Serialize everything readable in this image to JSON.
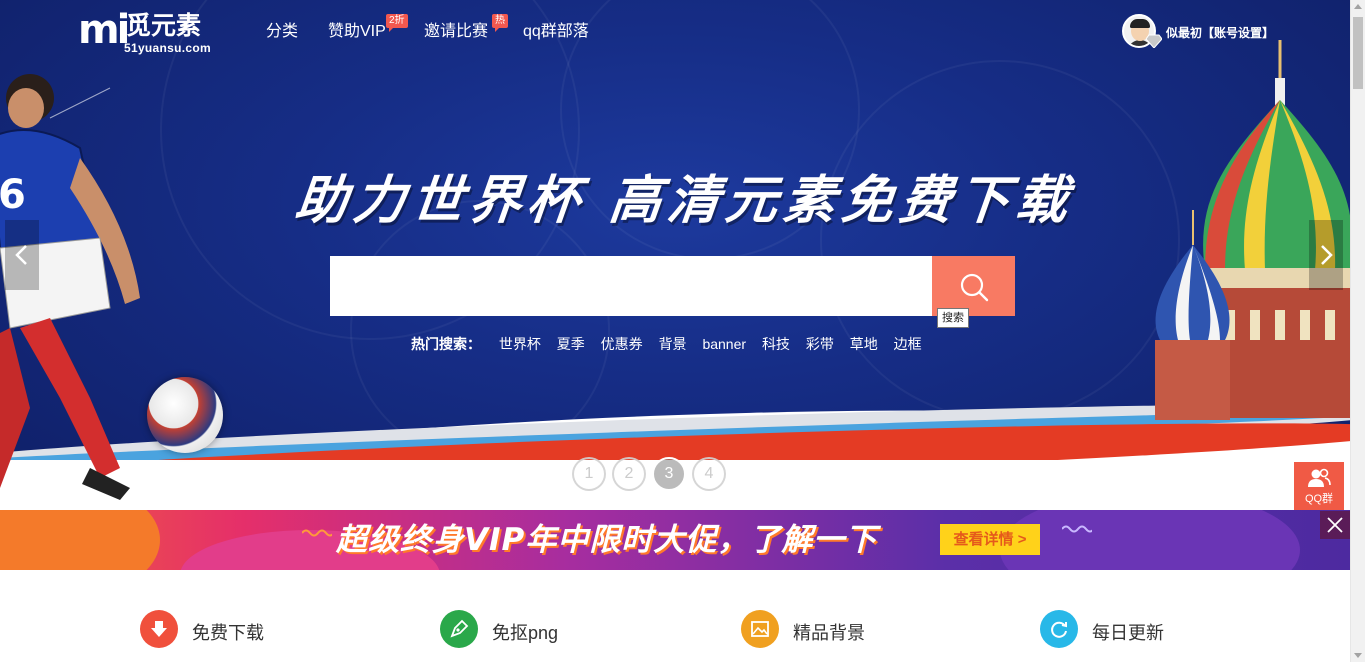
{
  "logo": {
    "mark": "mi",
    "name_cn": "觅元素",
    "domain": "51yuansu.com"
  },
  "nav": {
    "items": [
      {
        "label": "分类"
      },
      {
        "label": "赞助VIP",
        "badge": "2折"
      },
      {
        "label": "邀请比赛",
        "badge": "热"
      },
      {
        "label": "qq群部落"
      }
    ]
  },
  "user": {
    "name": "似最初【账号设置】"
  },
  "hero": {
    "headline": "助力世界杯  高清元素免费下载",
    "search": {
      "value": "",
      "placeholder": "",
      "button_tooltip": "搜索"
    },
    "hot": {
      "label": "热门搜索：",
      "tags": [
        "世界杯",
        "夏季",
        "优惠券",
        "背景",
        "banner",
        "科技",
        "彩带",
        "草地",
        "边框"
      ]
    },
    "slides": [
      "1",
      "2",
      "3",
      "4"
    ],
    "active_slide": "3"
  },
  "float": {
    "qq_label": "QQ群"
  },
  "promo": {
    "text": "超级终身VIP年中限时大促，了解一下",
    "button": "查看详情 >"
  },
  "features": [
    {
      "label": "免费下载",
      "icon": "download-arrow-icon",
      "color": "#f0503c"
    },
    {
      "label": "免抠png",
      "icon": "pen-nib-icon",
      "color": "#2aa84a"
    },
    {
      "label": "精品背景",
      "icon": "picture-icon",
      "color": "#f0a020"
    },
    {
      "label": "每日更新",
      "icon": "refresh-icon",
      "color": "#28b8e8"
    }
  ],
  "colors": {
    "accent": "#f87a63",
    "hero_bg": "#162d86",
    "promo_button": "#ffd21a"
  }
}
